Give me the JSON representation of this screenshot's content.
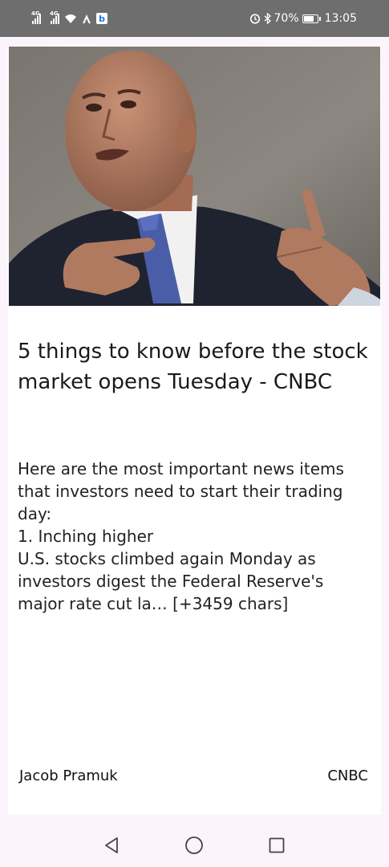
{
  "status_bar": {
    "signal1_label": "4G",
    "signal2_label": "4G",
    "battery": "70%",
    "time": "13:05",
    "badge": "b"
  },
  "article": {
    "image_alt": "Man in dark suit and blue tie gesturing while speaking",
    "title": "5 things to know before the stock market opens Tuesday - CNBC",
    "body": "Here are the most important news items that investors need to start their trading day:\n1. Inching higher\nU.S. stocks climbed again Monday as investors digest the Federal Reserve's major rate cut la… [+3459 chars]",
    "author": "Jacob Pramuk",
    "source": "CNBC"
  },
  "nav": {
    "back": "back",
    "home": "home",
    "recents": "recents"
  }
}
